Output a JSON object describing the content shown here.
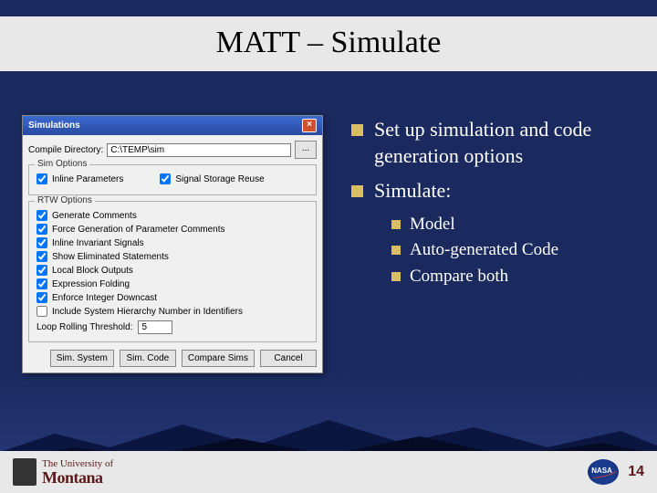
{
  "slide": {
    "title": "MATT – Simulate",
    "page_number": "14",
    "logo_line1": "The University of",
    "logo_line2": "Montana",
    "nasa": "NASA"
  },
  "bullets": {
    "b1": "Set up simulation and code generation options",
    "b2": "Simulate:",
    "sub1": "Model",
    "sub2": "Auto-generated Code",
    "sub3": "Compare both"
  },
  "dialog": {
    "title": "Simulations",
    "compile_label": "Compile Directory:",
    "compile_value": "C:\\TEMP\\sim",
    "dots": "...",
    "grp_sim": "Sim Options",
    "chk_inline_params": "Inline Parameters",
    "chk_signal_reuse": "Signal Storage Reuse",
    "grp_rtw": "RTW Options",
    "chk_gen_comments": "Generate Comments",
    "chk_force_param": "Force Generation of Parameter Comments",
    "chk_inline_inv": "Inline Invariant Signals",
    "chk_show_elim": "Show Eliminated Statements",
    "chk_local_block": "Local Block Outputs",
    "chk_expr_fold": "Expression Folding",
    "chk_enforce_int": "Enforce Integer Downcast",
    "chk_include_hier": "Include System Hierarchy Number in Identifiers",
    "thresh_label": "Loop Rolling Threshold:",
    "thresh_value": "5",
    "btn_sim_system": "Sim. System",
    "btn_sim_code": "Sim. Code",
    "btn_compare": "Compare Sims",
    "btn_cancel": "Cancel"
  }
}
